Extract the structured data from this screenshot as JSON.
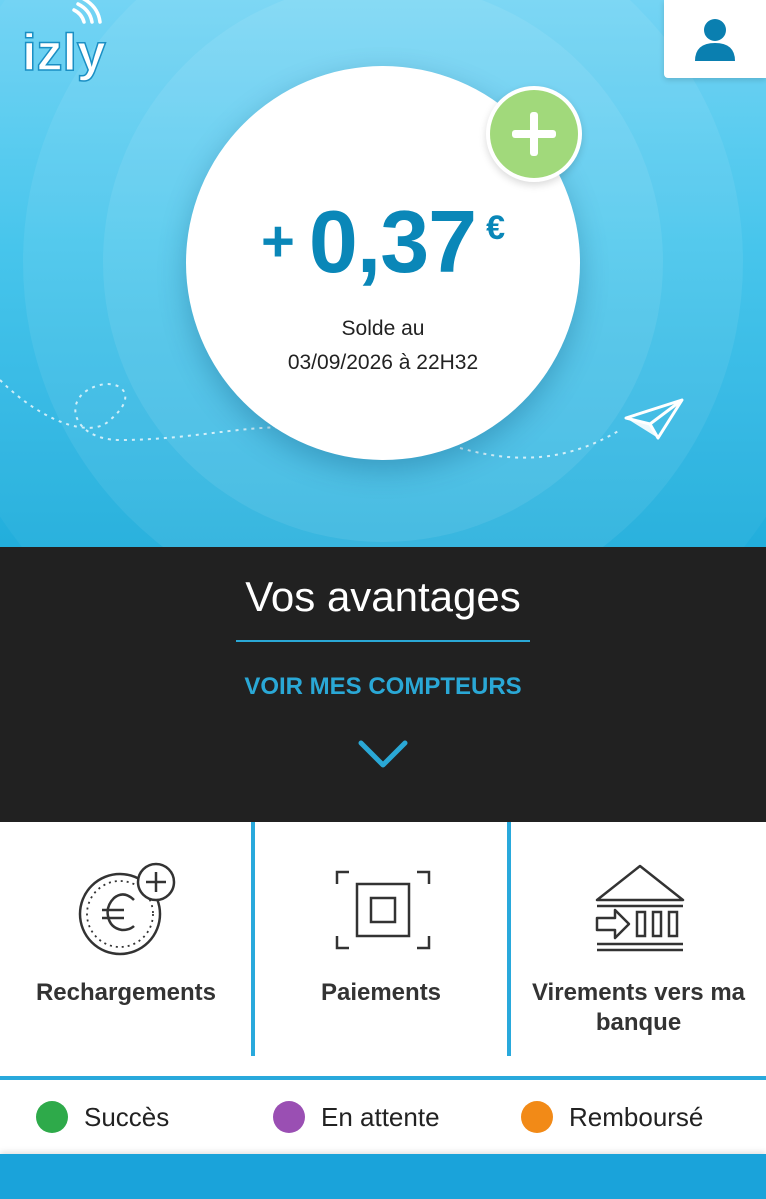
{
  "app": {
    "logo_text": "izly"
  },
  "header": {
    "profile_icon": "user-icon"
  },
  "balance": {
    "sign": "+",
    "value": "0,37",
    "currency": "€",
    "label_line1": "Solde au",
    "label_line2": "03/09/2026 à 22H32",
    "add_icon": "plus-icon"
  },
  "avantages": {
    "title": "Vos avantages",
    "link": "VOIR MES COMPTEURS",
    "chevron_icon": "chevron-down-icon"
  },
  "actions": [
    {
      "label": "Rechargements",
      "icon": "euro-coin-plus-icon"
    },
    {
      "label": "Paiements",
      "icon": "scan-frame-icon"
    },
    {
      "label": "Virements vers ma banque",
      "icon": "bank-transfer-icon"
    }
  ],
  "legend": [
    {
      "label": "Succès",
      "color": "#2eaa4a"
    },
    {
      "label": "En attente",
      "color": "#9a4fb3"
    },
    {
      "label": "Remboursé",
      "color": "#f28a17"
    }
  ],
  "colors": {
    "accent": "#29a9dc",
    "balance_text": "#0a87b8",
    "add_button": "#a1d97b",
    "dark_panel": "#212121"
  }
}
